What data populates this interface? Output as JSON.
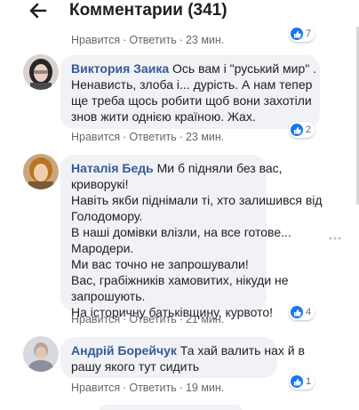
{
  "header": {
    "title": "Комментарии (341)"
  },
  "actions": {
    "like": "Нравится",
    "reply": "Ответить",
    "separator": "·"
  },
  "comments": [
    {
      "time": "23 мин.",
      "likes": "7"
    },
    {
      "author": "Виктория Заика",
      "lines": [
        "Ось вам і \"руський мир\" .",
        "Ненависть, злоба і... дурість. А нам тепер",
        "ще треба щось робити щоб вони захотіли",
        "знов жити однією країною. Жах."
      ],
      "time": "23 мин.",
      "likes": "2"
    },
    {
      "author": "Наталія Бедь",
      "lines": [
        "Ми б підняли без вас,",
        "криворукі!",
        "Навіть якби піднімали ті, хто залишився від",
        "Голодомору.",
        "В наші домівки влізли, на все готове...",
        "Мародери.",
        "Ми вас точно не запрошували!",
        "Вас, грабіжників хамовитих, нікуди не",
        "запрошують.",
        "На історичну батьківщину, курвото!"
      ],
      "time": "21 мин.",
      "likes": "4"
    },
    {
      "author": "Андрій Борейчук",
      "lines": [
        "Та хай валить нах й в",
        "рашу якого тут сидить"
      ],
      "time": "19 мин.",
      "likes": "1"
    }
  ],
  "colors": {
    "accent": "#1877f2",
    "author": "#385898",
    "bubble": "#f0f2f5",
    "meta": "#65676b"
  }
}
